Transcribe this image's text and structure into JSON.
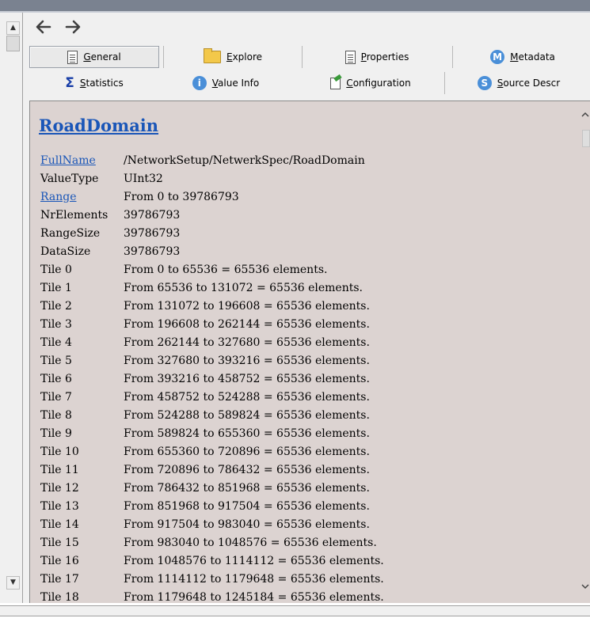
{
  "nav": {
    "back_icon": "arrow-left-icon",
    "forward_icon": "arrow-right-icon"
  },
  "tabs": [
    {
      "label": "General",
      "icon": "document-icon"
    },
    {
      "label": "Explore",
      "icon": "folder-icon"
    },
    {
      "label": "Properties",
      "icon": "document-icon"
    },
    {
      "label": "Metadata",
      "icon": "metadata-icon"
    },
    {
      "label": "Statistics",
      "icon": "sigma-icon"
    },
    {
      "label": "Value Info",
      "icon": "info-icon"
    },
    {
      "label": "Configuration",
      "icon": "configuration-icon"
    },
    {
      "label": "Source Descr",
      "icon": "source-icon"
    }
  ],
  "icon_letters": {
    "metadata": "M",
    "info": "i",
    "source": "S"
  },
  "content": {
    "title": "RoadDomain",
    "rows": [
      {
        "key": "FullName",
        "value": "/NetworkSetup/NetwerkSpec/RoadDomain",
        "key_link": true
      },
      {
        "key": "ValueType",
        "value": "UInt32",
        "key_link": false
      },
      {
        "key": "Range",
        "value": "From 0 to 39786793",
        "key_link": true
      },
      {
        "key": "NrElements",
        "value": "39786793",
        "key_link": false
      },
      {
        "key": "RangeSize",
        "value": "39786793",
        "key_link": false
      },
      {
        "key": "DataSize",
        "value": "39786793",
        "key_link": false
      },
      {
        "key": "Tile 0",
        "value": "From 0 to 65536 = 65536 elements.",
        "key_link": false
      },
      {
        "key": "Tile 1",
        "value": "From 65536 to 131072 = 65536 elements.",
        "key_link": false
      },
      {
        "key": "Tile 2",
        "value": "From 131072 to 196608 = 65536 elements.",
        "key_link": false
      },
      {
        "key": "Tile 3",
        "value": "From 196608 to 262144 = 65536 elements.",
        "key_link": false
      },
      {
        "key": "Tile 4",
        "value": "From 262144 to 327680 = 65536 elements.",
        "key_link": false
      },
      {
        "key": "Tile 5",
        "value": "From 327680 to 393216 = 65536 elements.",
        "key_link": false
      },
      {
        "key": "Tile 6",
        "value": "From 393216 to 458752 = 65536 elements.",
        "key_link": false
      },
      {
        "key": "Tile 7",
        "value": "From 458752 to 524288 = 65536 elements.",
        "key_link": false
      },
      {
        "key": "Tile 8",
        "value": "From 524288 to 589824 = 65536 elements.",
        "key_link": false
      },
      {
        "key": "Tile 9",
        "value": "From 589824 to 655360 = 65536 elements.",
        "key_link": false
      },
      {
        "key": "Tile 10",
        "value": "From 655360 to 720896 = 65536 elements.",
        "key_link": false
      },
      {
        "key": "Tile 11",
        "value": "From 720896 to 786432 = 65536 elements.",
        "key_link": false
      },
      {
        "key": "Tile 12",
        "value": "From 786432 to 851968 = 65536 elements.",
        "key_link": false
      },
      {
        "key": "Tile 13",
        "value": "From 851968 to 917504 = 65536 elements.",
        "key_link": false
      },
      {
        "key": "Tile 14",
        "value": "From 917504 to 983040 = 65536 elements.",
        "key_link": false
      },
      {
        "key": "Tile 15",
        "value": "From 983040 to 1048576 = 65536 elements.",
        "key_link": false
      },
      {
        "key": "Tile 16",
        "value": "From 1048576 to 1114112 = 65536 elements.",
        "key_link": false
      },
      {
        "key": "Tile 17",
        "value": "From 1114112 to 1179648 = 65536 elements.",
        "key_link": false
      },
      {
        "key": "Tile 18",
        "value": "From 1179648 to 1245184 = 65536 elements.",
        "key_link": false
      }
    ]
  },
  "colors": {
    "link": "#1a56b8",
    "panel_bg": "#dcd3d1",
    "titlebar": "#7a8290"
  }
}
